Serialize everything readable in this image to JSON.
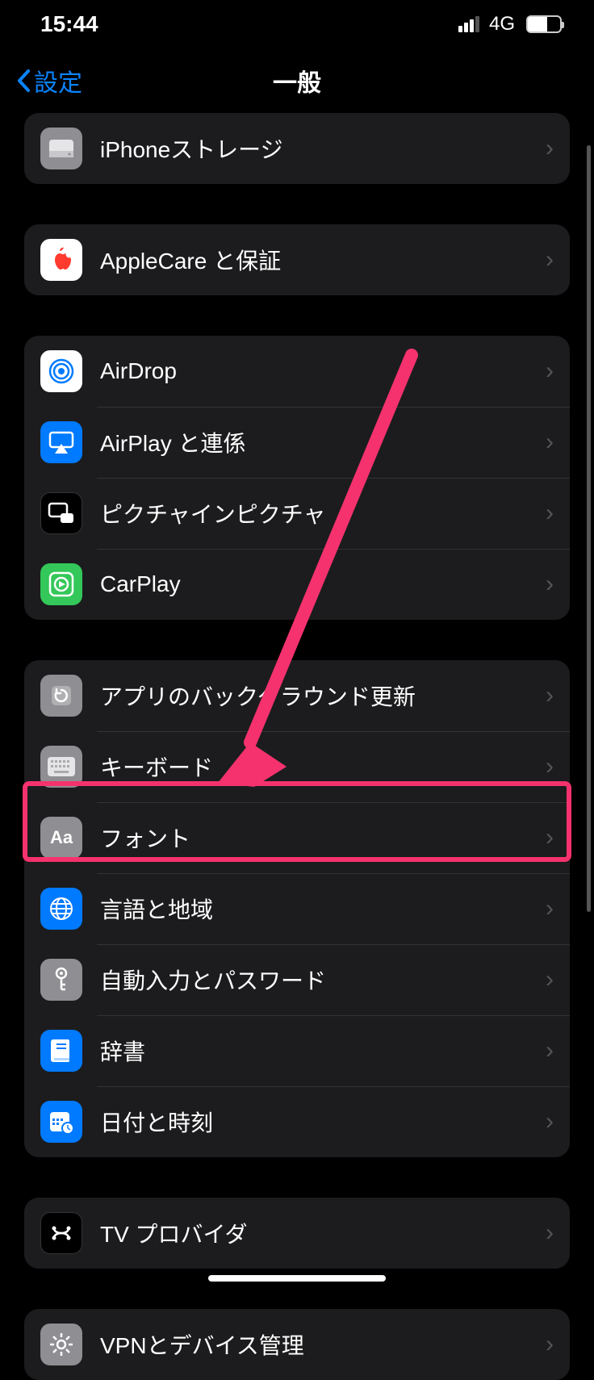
{
  "status": {
    "time": "15:44",
    "network": "4G"
  },
  "nav": {
    "back": "設定",
    "title": "一般"
  },
  "groups": [
    {
      "rows": [
        {
          "key": "storage",
          "label": "iPhoneストレージ"
        }
      ]
    },
    {
      "rows": [
        {
          "key": "applecare",
          "label": "AppleCare と保証"
        }
      ]
    },
    {
      "rows": [
        {
          "key": "airdrop",
          "label": "AirDrop"
        },
        {
          "key": "airplay",
          "label": "AirPlay と連係"
        },
        {
          "key": "pip",
          "label": "ピクチャインピクチャ"
        },
        {
          "key": "carplay",
          "label": "CarPlay"
        }
      ]
    },
    {
      "rows": [
        {
          "key": "bgrefresh",
          "label": "アプリのバックグラウンド更新"
        },
        {
          "key": "keyboard",
          "label": "キーボード"
        },
        {
          "key": "fonts",
          "label": "フォント"
        },
        {
          "key": "language",
          "label": "言語と地域"
        },
        {
          "key": "autofill",
          "label": "自動入力とパスワード"
        },
        {
          "key": "dictionary",
          "label": "辞書"
        },
        {
          "key": "datetime",
          "label": "日付と時刻"
        }
      ]
    },
    {
      "rows": [
        {
          "key": "tvprovider",
          "label": "TV プロバイダ"
        }
      ]
    },
    {
      "rows": [
        {
          "key": "vpn",
          "label": "VPNとデバイス管理"
        }
      ]
    }
  ],
  "fonts_badge": "Aa"
}
